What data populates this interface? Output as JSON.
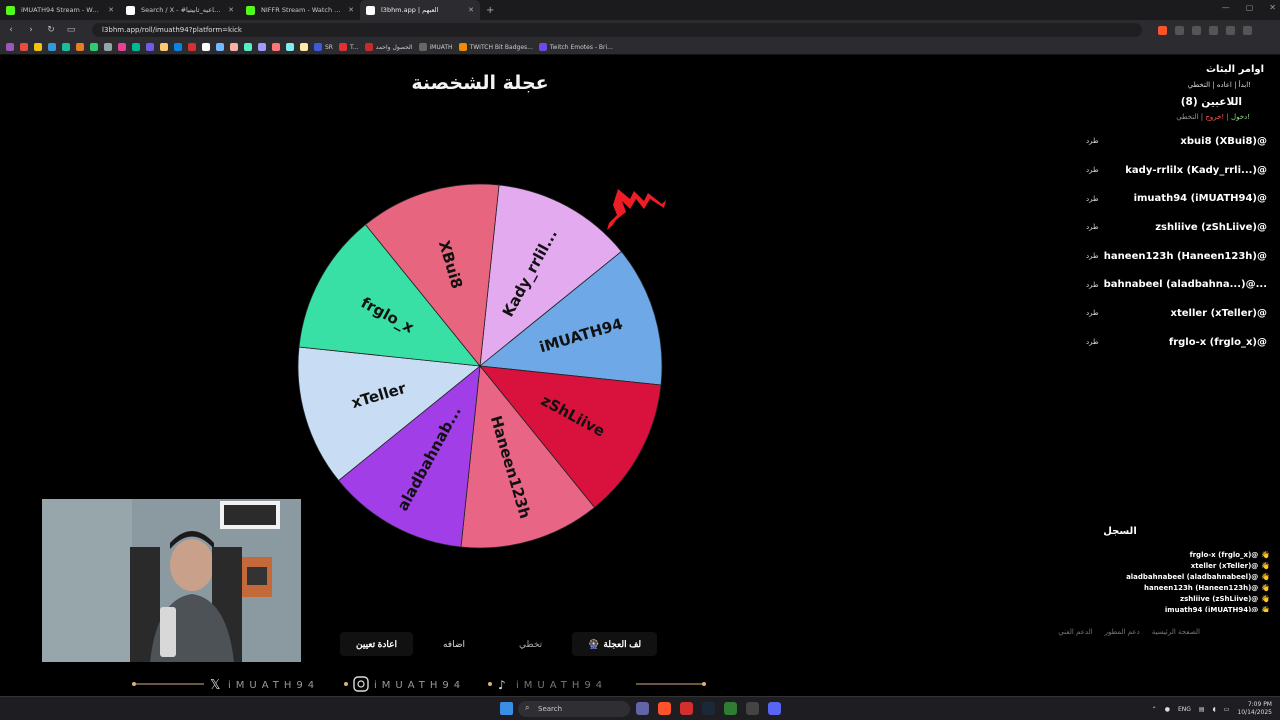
{
  "browser": {
    "tabs": [
      {
        "title": "iMUATH94 Stream - Watch Live o",
        "active": false,
        "color": "#53fc18"
      },
      {
        "title": "Search / X - #العاب_الاجتماعيه_ثابيتيا",
        "active": false,
        "color": "#ffffff"
      },
      {
        "title": "NIFFR Stream - Watch Live on Kick",
        "active": false,
        "color": "#53fc18"
      },
      {
        "title": "l3bhm.app | العبهم",
        "active": true,
        "color": "#ffffff"
      }
    ],
    "new_tab": "+",
    "url": "l3bhm.app/roll/imuath94?platform=kick",
    "bookmarks": [
      {
        "label": "SR",
        "color": "#3b5bdb"
      },
      {
        "label": "T...",
        "color": "#e03131"
      },
      {
        "label": "الحصول واحمد",
        "color": "#c92a2a"
      },
      {
        "label": "iMUATH",
        "color": "#666666"
      },
      {
        "label": "TWITCH Bit Badges...",
        "color": "#f08c00"
      },
      {
        "label": "Twitch Emotes - Bri...",
        "color": "#7048e8"
      }
    ]
  },
  "page": {
    "title": "عجلة الشخصنة",
    "wheel": {
      "segments": [
        {
          "label": "Kady_rrlil...",
          "color": "#e4aaf0"
        },
        {
          "label": "iMUATH94",
          "color": "#6fa8e6"
        },
        {
          "label": "zShLiive",
          "color": "#d9113d"
        },
        {
          "label": "Haneen123h",
          "color": "#e86586"
        },
        {
          "label": "aladbahnab...",
          "color": "#a13ee8"
        },
        {
          "label": "xTeller",
          "color": "#c8dcf4"
        },
        {
          "label": "frglo_x",
          "color": "#39e0a5"
        },
        {
          "label": "XBui8",
          "color": "#e8657f"
        }
      ],
      "pointer_color": "#ee1c25"
    },
    "buttons": {
      "reset": "اعادة تعيين",
      "add": "اضافه",
      "skip": "تخطي",
      "spin": "لف العجلة",
      "spin_icon": "🎡"
    }
  },
  "sidebar": {
    "commands_title": "اوامر البثاث",
    "commands_line": "!ابدأ | اعاده | التخطي",
    "players_title": "اللاعبين (8)",
    "join_label": "!دخول",
    "leave_label": "!خروج",
    "skip_label": "التخطي",
    "kick_label": "طرد",
    "players": [
      "xbui8 (XBui8)@",
      "kady-rrlilx (Kady_rrli...)@",
      "imuath94 (iMUATH94)@",
      "zshliive (zShLiive)@",
      "haneen123h (Haneen123h)@",
      "bahnabeel (aladbahna...)@...",
      "xteller (xTeller)@",
      "frglo-x (frglo_x)@"
    ],
    "log_title": "السجل",
    "log": [
      "frglo-x (frglo_x)@",
      "xteller (xTeller)@",
      "aladbahnabeel (aladbahnabeel)@",
      "haneen123h (Haneen123h)@",
      "zshliive (zShLiive)@",
      "imuath94 (iMUATH94)@"
    ],
    "footer_links": [
      "الصفحة الرئيسية",
      "دعم المطور",
      "الدعم الفني"
    ]
  },
  "overlay": {
    "handle": "iMUATH94",
    "icons": [
      "x-icon",
      "instagram-icon",
      "tiktok-icon"
    ]
  },
  "taskbar": {
    "search_placeholder": "Search",
    "language": "ENG",
    "time": "7:09 PM",
    "date": "10/14/2025"
  }
}
